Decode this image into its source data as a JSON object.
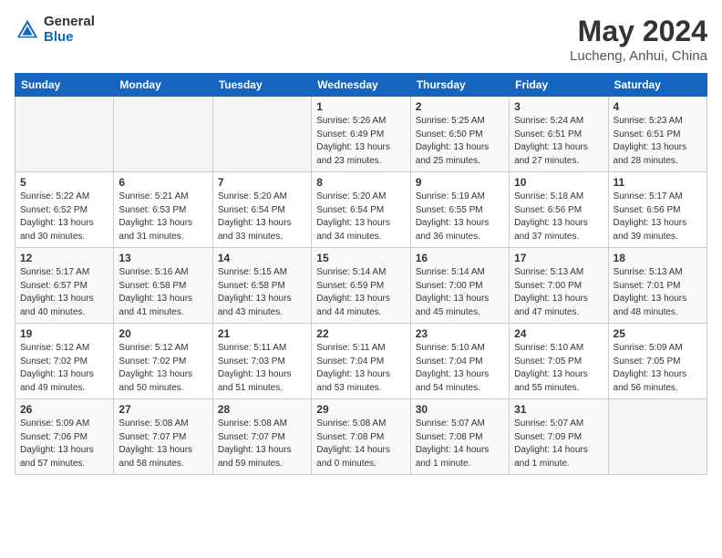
{
  "logo": {
    "general": "General",
    "blue": "Blue"
  },
  "title": {
    "month": "May 2024",
    "location": "Lucheng, Anhui, China"
  },
  "weekdays": [
    "Sunday",
    "Monday",
    "Tuesday",
    "Wednesday",
    "Thursday",
    "Friday",
    "Saturday"
  ],
  "weeks": [
    [
      {
        "day": "",
        "sunrise": "",
        "sunset": "",
        "daylight": ""
      },
      {
        "day": "",
        "sunrise": "",
        "sunset": "",
        "daylight": ""
      },
      {
        "day": "",
        "sunrise": "",
        "sunset": "",
        "daylight": ""
      },
      {
        "day": "1",
        "sunrise": "Sunrise: 5:26 AM",
        "sunset": "Sunset: 6:49 PM",
        "daylight": "Daylight: 13 hours and 23 minutes."
      },
      {
        "day": "2",
        "sunrise": "Sunrise: 5:25 AM",
        "sunset": "Sunset: 6:50 PM",
        "daylight": "Daylight: 13 hours and 25 minutes."
      },
      {
        "day": "3",
        "sunrise": "Sunrise: 5:24 AM",
        "sunset": "Sunset: 6:51 PM",
        "daylight": "Daylight: 13 hours and 27 minutes."
      },
      {
        "day": "4",
        "sunrise": "Sunrise: 5:23 AM",
        "sunset": "Sunset: 6:51 PM",
        "daylight": "Daylight: 13 hours and 28 minutes."
      }
    ],
    [
      {
        "day": "5",
        "sunrise": "Sunrise: 5:22 AM",
        "sunset": "Sunset: 6:52 PM",
        "daylight": "Daylight: 13 hours and 30 minutes."
      },
      {
        "day": "6",
        "sunrise": "Sunrise: 5:21 AM",
        "sunset": "Sunset: 6:53 PM",
        "daylight": "Daylight: 13 hours and 31 minutes."
      },
      {
        "day": "7",
        "sunrise": "Sunrise: 5:20 AM",
        "sunset": "Sunset: 6:54 PM",
        "daylight": "Daylight: 13 hours and 33 minutes."
      },
      {
        "day": "8",
        "sunrise": "Sunrise: 5:20 AM",
        "sunset": "Sunset: 6:54 PM",
        "daylight": "Daylight: 13 hours and 34 minutes."
      },
      {
        "day": "9",
        "sunrise": "Sunrise: 5:19 AM",
        "sunset": "Sunset: 6:55 PM",
        "daylight": "Daylight: 13 hours and 36 minutes."
      },
      {
        "day": "10",
        "sunrise": "Sunrise: 5:18 AM",
        "sunset": "Sunset: 6:56 PM",
        "daylight": "Daylight: 13 hours and 37 minutes."
      },
      {
        "day": "11",
        "sunrise": "Sunrise: 5:17 AM",
        "sunset": "Sunset: 6:56 PM",
        "daylight": "Daylight: 13 hours and 39 minutes."
      }
    ],
    [
      {
        "day": "12",
        "sunrise": "Sunrise: 5:17 AM",
        "sunset": "Sunset: 6:57 PM",
        "daylight": "Daylight: 13 hours and 40 minutes."
      },
      {
        "day": "13",
        "sunrise": "Sunrise: 5:16 AM",
        "sunset": "Sunset: 6:58 PM",
        "daylight": "Daylight: 13 hours and 41 minutes."
      },
      {
        "day": "14",
        "sunrise": "Sunrise: 5:15 AM",
        "sunset": "Sunset: 6:58 PM",
        "daylight": "Daylight: 13 hours and 43 minutes."
      },
      {
        "day": "15",
        "sunrise": "Sunrise: 5:14 AM",
        "sunset": "Sunset: 6:59 PM",
        "daylight": "Daylight: 13 hours and 44 minutes."
      },
      {
        "day": "16",
        "sunrise": "Sunrise: 5:14 AM",
        "sunset": "Sunset: 7:00 PM",
        "daylight": "Daylight: 13 hours and 45 minutes."
      },
      {
        "day": "17",
        "sunrise": "Sunrise: 5:13 AM",
        "sunset": "Sunset: 7:00 PM",
        "daylight": "Daylight: 13 hours and 47 minutes."
      },
      {
        "day": "18",
        "sunrise": "Sunrise: 5:13 AM",
        "sunset": "Sunset: 7:01 PM",
        "daylight": "Daylight: 13 hours and 48 minutes."
      }
    ],
    [
      {
        "day": "19",
        "sunrise": "Sunrise: 5:12 AM",
        "sunset": "Sunset: 7:02 PM",
        "daylight": "Daylight: 13 hours and 49 minutes."
      },
      {
        "day": "20",
        "sunrise": "Sunrise: 5:12 AM",
        "sunset": "Sunset: 7:02 PM",
        "daylight": "Daylight: 13 hours and 50 minutes."
      },
      {
        "day": "21",
        "sunrise": "Sunrise: 5:11 AM",
        "sunset": "Sunset: 7:03 PM",
        "daylight": "Daylight: 13 hours and 51 minutes."
      },
      {
        "day": "22",
        "sunrise": "Sunrise: 5:11 AM",
        "sunset": "Sunset: 7:04 PM",
        "daylight": "Daylight: 13 hours and 53 minutes."
      },
      {
        "day": "23",
        "sunrise": "Sunrise: 5:10 AM",
        "sunset": "Sunset: 7:04 PM",
        "daylight": "Daylight: 13 hours and 54 minutes."
      },
      {
        "day": "24",
        "sunrise": "Sunrise: 5:10 AM",
        "sunset": "Sunset: 7:05 PM",
        "daylight": "Daylight: 13 hours and 55 minutes."
      },
      {
        "day": "25",
        "sunrise": "Sunrise: 5:09 AM",
        "sunset": "Sunset: 7:05 PM",
        "daylight": "Daylight: 13 hours and 56 minutes."
      }
    ],
    [
      {
        "day": "26",
        "sunrise": "Sunrise: 5:09 AM",
        "sunset": "Sunset: 7:06 PM",
        "daylight": "Daylight: 13 hours and 57 minutes."
      },
      {
        "day": "27",
        "sunrise": "Sunrise: 5:08 AM",
        "sunset": "Sunset: 7:07 PM",
        "daylight": "Daylight: 13 hours and 58 minutes."
      },
      {
        "day": "28",
        "sunrise": "Sunrise: 5:08 AM",
        "sunset": "Sunset: 7:07 PM",
        "daylight": "Daylight: 13 hours and 59 minutes."
      },
      {
        "day": "29",
        "sunrise": "Sunrise: 5:08 AM",
        "sunset": "Sunset: 7:08 PM",
        "daylight": "Daylight: 14 hours and 0 minutes."
      },
      {
        "day": "30",
        "sunrise": "Sunrise: 5:07 AM",
        "sunset": "Sunset: 7:08 PM",
        "daylight": "Daylight: 14 hours and 1 minute."
      },
      {
        "day": "31",
        "sunrise": "Sunrise: 5:07 AM",
        "sunset": "Sunset: 7:09 PM",
        "daylight": "Daylight: 14 hours and 1 minute."
      },
      {
        "day": "",
        "sunrise": "",
        "sunset": "",
        "daylight": ""
      }
    ]
  ]
}
